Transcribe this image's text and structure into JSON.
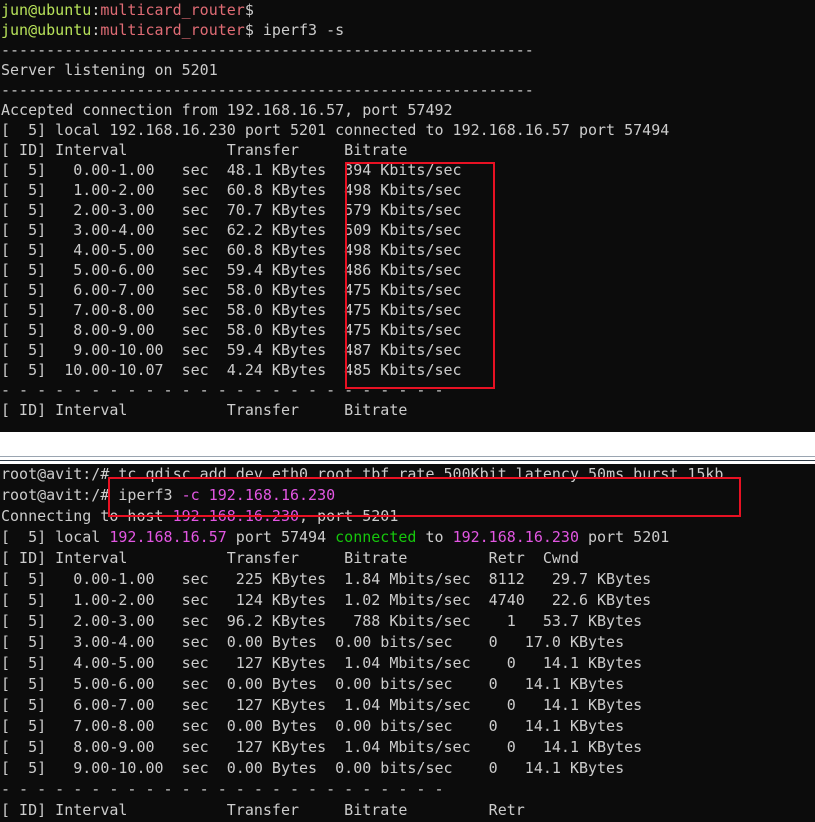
{
  "server": {
    "prompt1": {
      "user": "jun@ubuntu",
      "path": "multicard_router",
      "sym": "$",
      "cmd": ""
    },
    "prompt2": {
      "user": "jun@ubuntu",
      "path": "multicard_router",
      "sym": "$",
      "cmd": " iperf3 -s"
    },
    "lines": [
      "-----------------------------------------------------------",
      "Server listening on 5201",
      "-----------------------------------------------------------",
      "Accepted connection from 192.168.16.57, port 57492",
      "[  5] local 192.168.16.230 port 5201 connected to 192.168.16.57 port 57494",
      "[ ID] Interval           Transfer     Bitrate",
      "[  5]   0.00-1.00   sec  48.1 KBytes  394 Kbits/sec",
      "[  5]   1.00-2.00   sec  60.8 KBytes  498 Kbits/sec",
      "[  5]   2.00-3.00   sec  70.7 KBytes  579 Kbits/sec",
      "[  5]   3.00-4.00   sec  62.2 KBytes  509 Kbits/sec",
      "[  5]   4.00-5.00   sec  60.8 KBytes  498 Kbits/sec",
      "[  5]   5.00-6.00   sec  59.4 KBytes  486 Kbits/sec",
      "[  5]   6.00-7.00   sec  58.0 KBytes  475 Kbits/sec",
      "[  5]   7.00-8.00   sec  58.0 KBytes  475 Kbits/sec",
      "[  5]   8.00-9.00   sec  58.0 KBytes  475 Kbits/sec",
      "[  5]   9.00-10.00  sec  59.4 KBytes  487 Kbits/sec",
      "[  5]  10.00-10.07  sec  4.24 KBytes  485 Kbits/sec",
      "- - - - - - - - - - - - - - - - - - - - - - - - -",
      "[ ID] Interval           Transfer     Bitrate"
    ]
  },
  "client": {
    "cmd1": {
      "prompt": "root@avit:/#",
      "cmd": " tc qdisc add dev eth0 root tbf rate 500Kbit latency 50ms burst 15kb"
    },
    "cmd2": {
      "prompt": "root@avit:/#",
      "cmd": " iperf3 ",
      "flag": "-c",
      "space": " ",
      "host": "192.168.16.230"
    },
    "connecting": {
      "pre": "Connecting to host ",
      "host": "192.168.16.230",
      "post": ", port 5201"
    },
    "local": {
      "pre": "[  5] local ",
      "ip1": "192.168.16.57",
      "mid1": " port 57494 ",
      "word": "connected",
      "mid2": " to ",
      "ip2": "192.168.16.230",
      "post": " port 5201"
    },
    "lines": [
      "[ ID] Interval           Transfer     Bitrate         Retr  Cwnd",
      "[  5]   0.00-1.00   sec   225 KBytes  1.84 Mbits/sec  8112   29.7 KBytes",
      "[  5]   1.00-2.00   sec   124 KBytes  1.02 Mbits/sec  4740   22.6 KBytes",
      "[  5]   2.00-3.00   sec  96.2 KBytes   788 Kbits/sec    1   53.7 KBytes",
      "[  5]   3.00-4.00   sec  0.00 Bytes  0.00 bits/sec    0   17.0 KBytes",
      "[  5]   4.00-5.00   sec   127 KBytes  1.04 Mbits/sec    0   14.1 KBytes",
      "[  5]   5.00-6.00   sec  0.00 Bytes  0.00 bits/sec    0   14.1 KBytes",
      "[  5]   6.00-7.00   sec   127 KBytes  1.04 Mbits/sec    0   14.1 KBytes",
      "[  5]   7.00-8.00   sec  0.00 Bytes  0.00 bits/sec    0   14.1 KBytes",
      "[  5]   8.00-9.00   sec   127 KBytes  1.04 Mbits/sec    0   14.1 KBytes",
      "[  5]   9.00-10.00  sec  0.00 Bytes  0.00 bits/sec    0   14.1 KBytes",
      "- - - - - - - - - - - - - - - - - - - - - - - - -",
      "[ ID] Interval           Transfer     Bitrate         Retr"
    ]
  }
}
